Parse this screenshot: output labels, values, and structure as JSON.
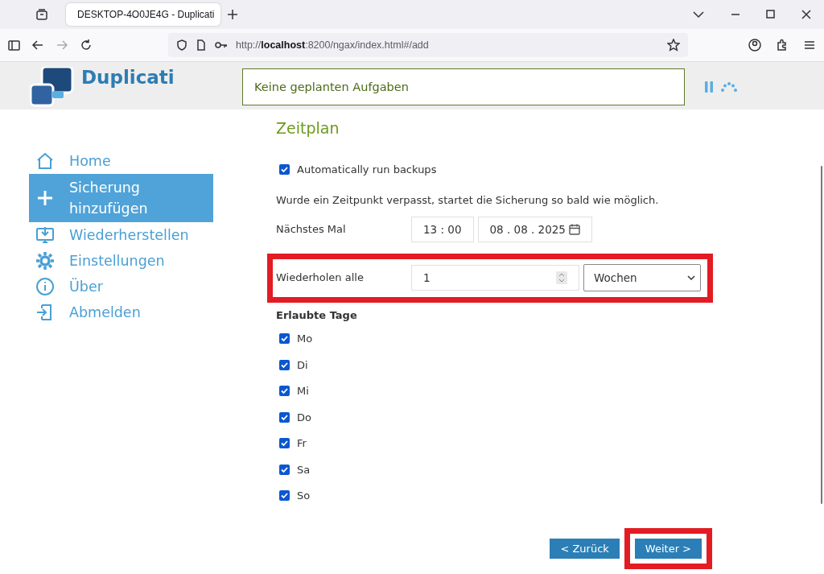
{
  "browser": {
    "tab_title": "DESKTOP-4O0JE4G - Duplicati",
    "url_scheme": "http://",
    "url_host": "localhost",
    "url_rest": ":8200/ngax/index.html#/add"
  },
  "app": {
    "logo_text": "Duplicati",
    "status": "Keine geplanten Aufgaben"
  },
  "sidebar": {
    "items": [
      {
        "label": "Home",
        "selected": false
      },
      {
        "label": "Sicherung hinzufügen",
        "selected": true
      },
      {
        "label": "Wiederherstellen",
        "selected": false
      },
      {
        "label": "Einstellungen",
        "selected": false
      },
      {
        "label": "Über",
        "selected": false
      },
      {
        "label": "Abmelden",
        "selected": false
      }
    ]
  },
  "form": {
    "title": "Zeitplan",
    "auto_run": {
      "label": "Automatically run backups",
      "checked": true
    },
    "note": "Wurde ein Zeitpunkt verpasst, startet die Sicherung so bald wie möglich.",
    "next_time": {
      "label": "Nächstes Mal",
      "time": "13 : 00",
      "date": "08 . 08 . 2025"
    },
    "repeat": {
      "label": "Wiederholen alle",
      "value": "1",
      "unit": "Wochen",
      "highlighted": true
    },
    "days_title": "Erlaubte Tage",
    "days": [
      {
        "label": "Mo",
        "checked": true
      },
      {
        "label": "Di",
        "checked": true
      },
      {
        "label": "Mi",
        "checked": true
      },
      {
        "label": "Do",
        "checked": true
      },
      {
        "label": "Fr",
        "checked": true
      },
      {
        "label": "Sa",
        "checked": true
      },
      {
        "label": "So",
        "checked": true
      }
    ]
  },
  "buttons": [
    {
      "label": "< Zurück",
      "highlighted": false
    },
    {
      "label": "Weiter >",
      "highlighted": true
    }
  ]
}
